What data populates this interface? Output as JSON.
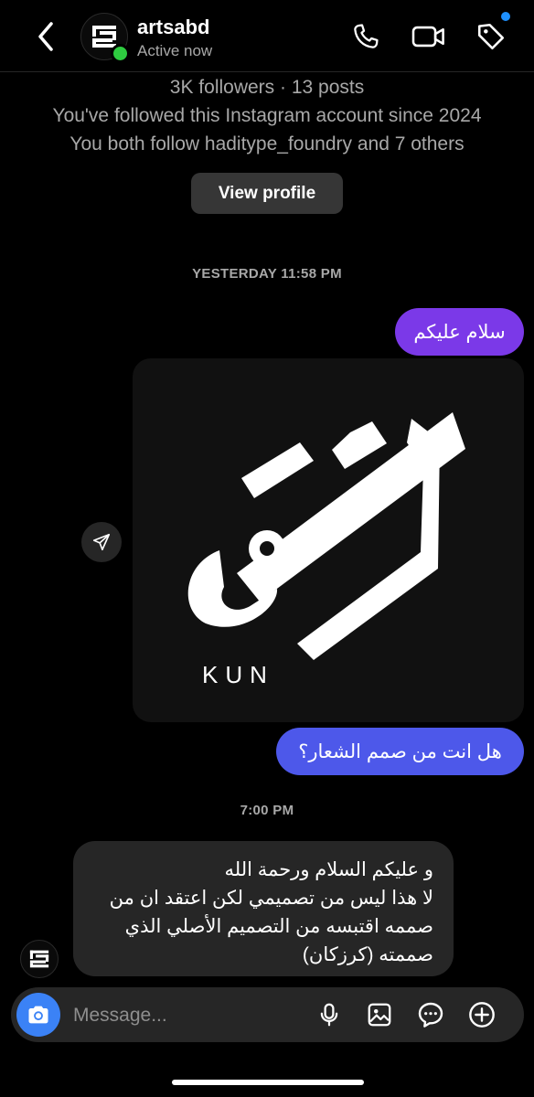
{
  "header": {
    "username": "artsabd",
    "status": "Active now"
  },
  "profile_info": {
    "stats": "3K followers · 13 posts",
    "followed_since": "You've followed this Instagram account since 2024",
    "mutuals": "You both follow haditype_foundry and 7 others",
    "view_profile_label": "View profile"
  },
  "timestamps": {
    "first": "YESTERDAY 11:58 PM",
    "second": "7:00 PM"
  },
  "messages": [
    {
      "sender": "me",
      "type": "text",
      "text": "سلام عليكم"
    },
    {
      "sender": "me",
      "type": "image",
      "caption": "KUN"
    },
    {
      "sender": "me",
      "type": "text",
      "text": "هل انت من صمم الشعار؟"
    },
    {
      "sender": "them",
      "type": "text",
      "lines": [
        "و عليكم السلام ورحمة الله",
        "لا هذا ليس من تصميمي لكن اعتقد ان من",
        "صممه اقتبسه من التصميم الأصلي الذي",
        "صممته (كرزكان)"
      ]
    }
  ],
  "composer": {
    "placeholder": "Message..."
  },
  "colors": {
    "background": "#000000",
    "sent_bubble_1": "#7b39e8",
    "sent_bubble_2": "#4d58ea",
    "received_bubble": "#262626",
    "camera_button": "#3b82f6",
    "online": "#2ecc40",
    "notification_dot": "#1e90ff"
  },
  "icons": [
    "back-icon",
    "phone-icon",
    "video-icon",
    "tag-icon",
    "share-icon",
    "camera-icon",
    "microphone-icon",
    "gallery-icon",
    "sticker-icon",
    "plus-icon"
  ]
}
